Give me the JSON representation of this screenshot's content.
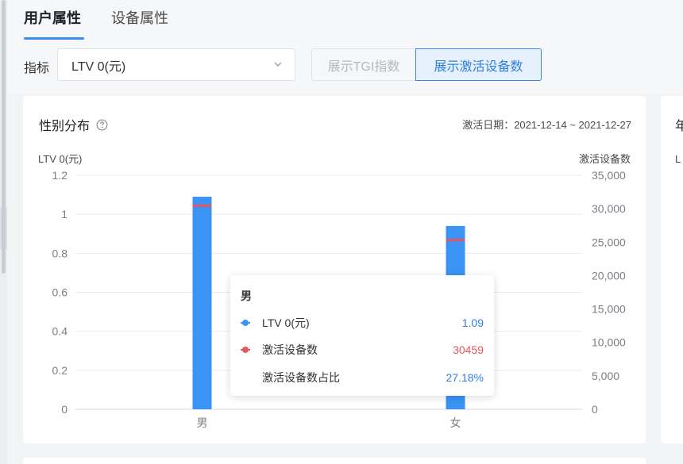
{
  "tabs": [
    {
      "label": "用户属性",
      "active": true
    },
    {
      "label": "设备属性",
      "active": false
    }
  ],
  "filter": {
    "label": "指标",
    "selected": "LTV 0(元)"
  },
  "toggles": [
    {
      "label": "展示TGI指数",
      "active": false
    },
    {
      "label": "展示激活设备数",
      "active": true
    }
  ],
  "card": {
    "title": "性别分布",
    "date_range": "激活日期：2021-12-14 ~ 2021-12-27"
  },
  "right_card": {
    "title_fragment": "年",
    "axis_fragment": "L"
  },
  "colors": {
    "accent": "#3b8bf5",
    "bar": "#3a93f5",
    "line": "#e8565b",
    "ratio_value": "#2f7fe0"
  },
  "chart_data": {
    "type": "bar",
    "categories": [
      "男",
      "女"
    ],
    "left_axis": {
      "label": "LTV 0(元)",
      "ticks": [
        "1.2",
        "1",
        "0.8",
        "0.6",
        "0.4",
        "0.2",
        "0"
      ],
      "ylim": [
        0,
        1.2
      ]
    },
    "right_axis": {
      "label": "激活设备数",
      "ticks": [
        "35,000",
        "30,000",
        "25,000",
        "20,000",
        "15,000",
        "10,000",
        "5,000",
        "0"
      ],
      "ylim": [
        0,
        35000
      ]
    },
    "series": [
      {
        "name": "LTV 0(元)",
        "type": "bar",
        "axis": "left",
        "values": [
          1.09,
          0.94
        ]
      },
      {
        "name": "激活设备数",
        "type": "line",
        "axis": "right",
        "values": [
          30459,
          25300
        ]
      }
    ],
    "grid": true
  },
  "tooltip": {
    "title": "男",
    "rows": [
      {
        "name": "LTV 0(元)",
        "value": "1.09",
        "marker": "bar"
      },
      {
        "name": "激活设备数",
        "value": "30459",
        "marker": "line"
      },
      {
        "name": "激活设备数占比",
        "value": "27.18%",
        "marker": "none"
      }
    ]
  }
}
